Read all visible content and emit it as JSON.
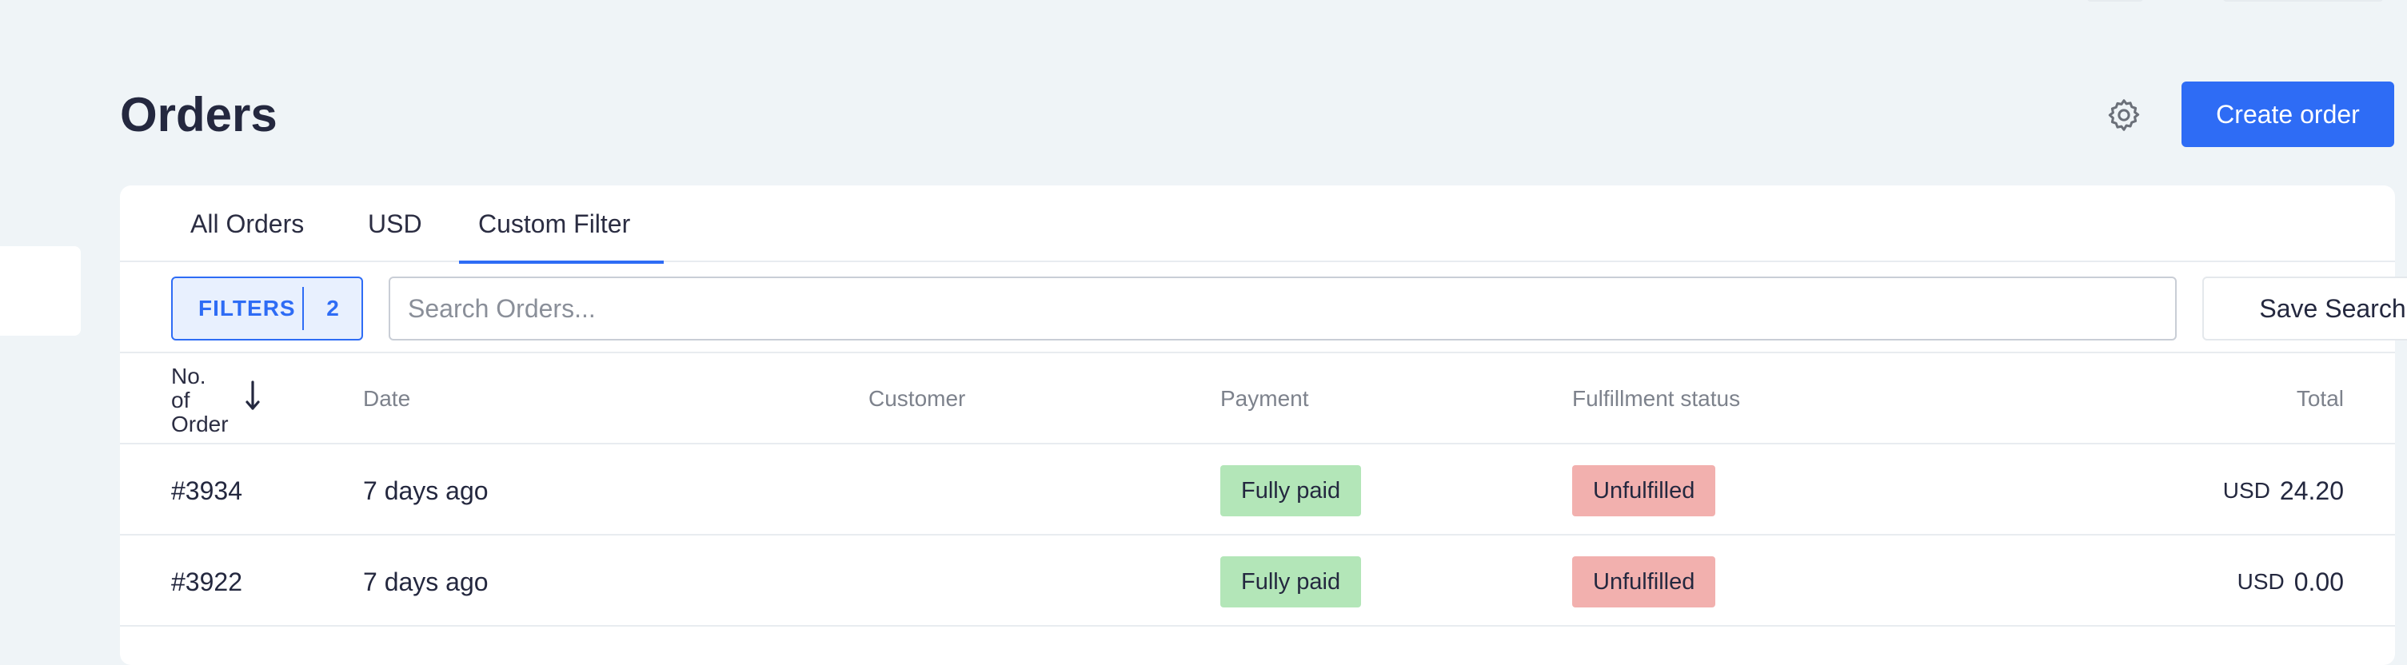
{
  "page": {
    "title": "Orders",
    "create_label": "Create order"
  },
  "tabs": [
    {
      "label": "All Orders",
      "active": false
    },
    {
      "label": "USD",
      "active": false
    },
    {
      "label": "Custom Filter",
      "active": true
    }
  ],
  "toolbar": {
    "filters_label": "FILTERS",
    "filters_count": "2",
    "search_placeholder": "Search Orders...",
    "search_value": "",
    "save_label": "Save Search"
  },
  "table": {
    "headers": {
      "order_line1": "No.",
      "order_line2": "of",
      "order_line3": "Order",
      "date": "Date",
      "customer": "Customer",
      "payment": "Payment",
      "fulfillment": "Fulfillment status",
      "total": "Total"
    },
    "rows": [
      {
        "order": "#3934",
        "date": "7 days ago",
        "customer": "",
        "payment": "Fully paid",
        "fulfillment": "Unfulfilled",
        "currency": "USD",
        "amount": "24.20"
      },
      {
        "order": "#3922",
        "date": "7 days ago",
        "customer": "",
        "payment": "Fully paid",
        "fulfillment": "Unfulfilled",
        "currency": "USD",
        "amount": "0.00"
      }
    ]
  },
  "icons": {
    "settings": "gear-icon",
    "sort": "arrow-down-icon"
  },
  "colors": {
    "accent": "#2e6cf5",
    "paid_badge": "#b3e6b8",
    "unfulfilled_badge": "#f2b0ae",
    "background": "#eff4f7"
  }
}
